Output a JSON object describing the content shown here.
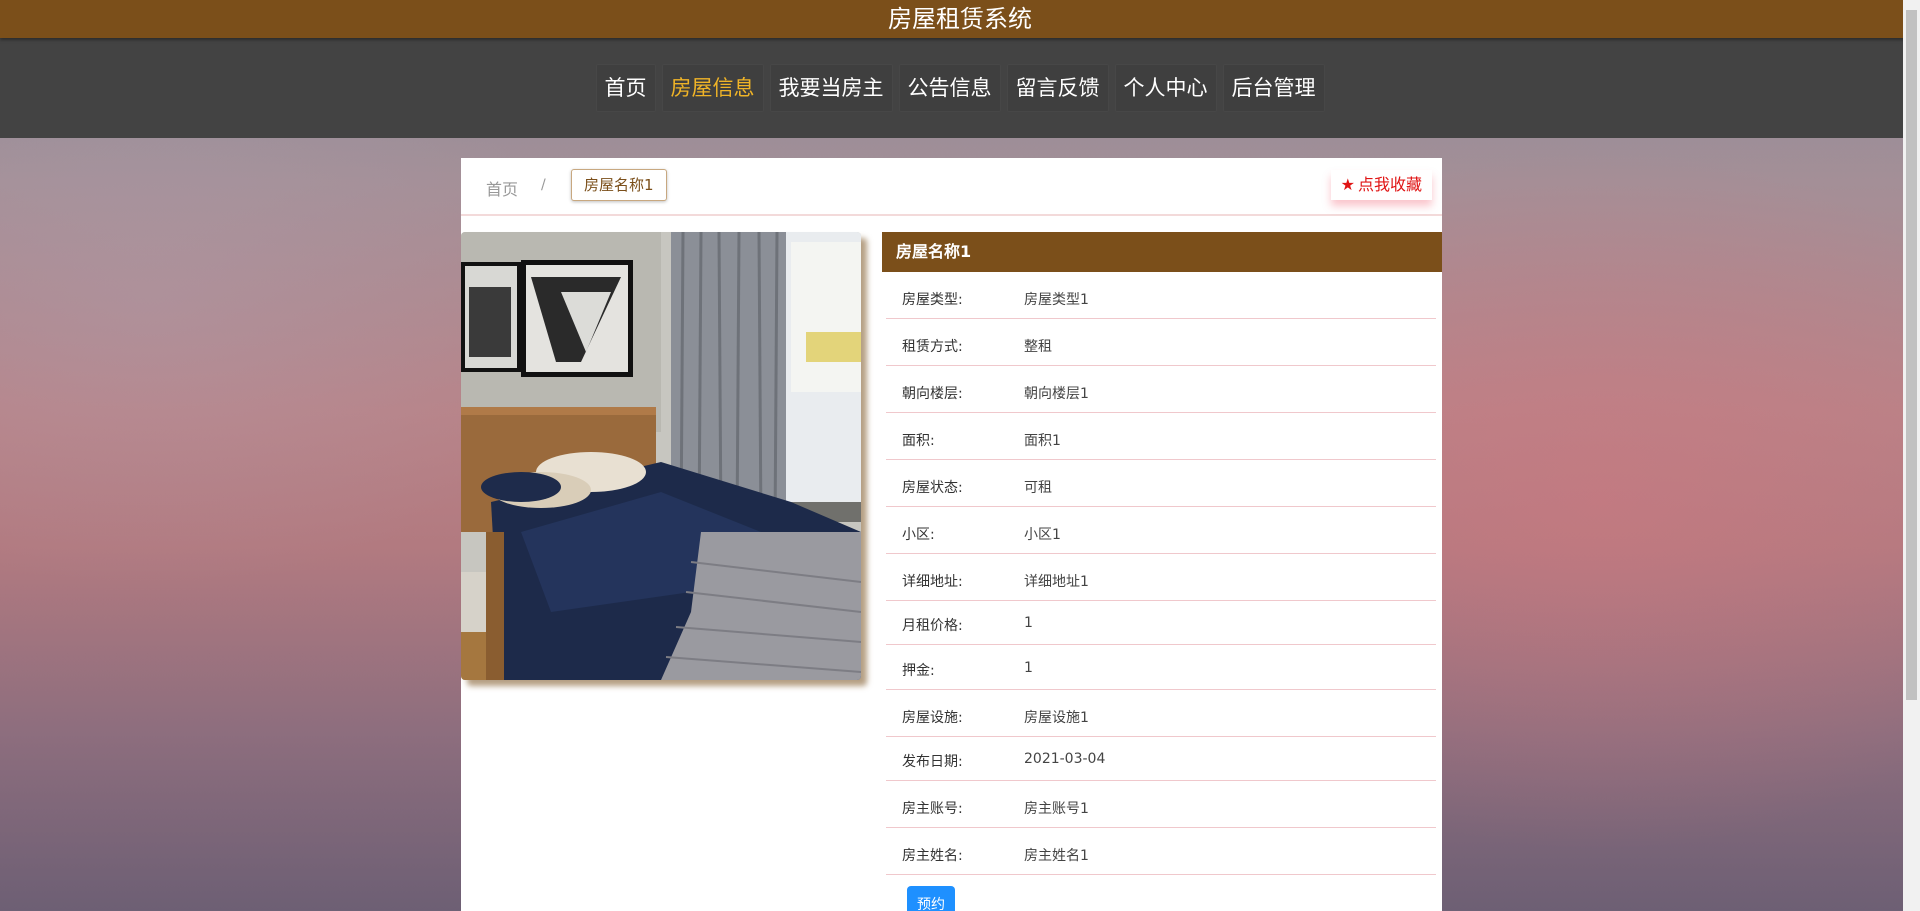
{
  "app": {
    "title": "房屋租赁系统"
  },
  "nav": {
    "items": [
      {
        "label": "首页"
      },
      {
        "label": "房屋信息"
      },
      {
        "label": "我要当房主"
      },
      {
        "label": "公告信息"
      },
      {
        "label": "留言反馈"
      },
      {
        "label": "个人中心"
      },
      {
        "label": "后台管理"
      }
    ],
    "active": "房屋信息"
  },
  "breadcrumb": {
    "home": "首页",
    "separator": "/",
    "current": "房屋名称1"
  },
  "favorite": {
    "icon": "star-icon",
    "label": "点我收藏"
  },
  "house": {
    "title": "房屋名称1",
    "fields": [
      {
        "label": "房屋类型:",
        "value": "房屋类型1"
      },
      {
        "label": "租赁方式:",
        "value": "整租"
      },
      {
        "label": "朝向楼层:",
        "value": "朝向楼层1"
      },
      {
        "label": "面积:",
        "value": "面积1"
      },
      {
        "label": "房屋状态:",
        "value": "可租"
      },
      {
        "label": "小区:",
        "value": "小区1"
      },
      {
        "label": "详细地址:",
        "value": "详细地址1"
      },
      {
        "label": "月租价格:",
        "value": "1"
      },
      {
        "label": "押金:",
        "value": "1"
      },
      {
        "label": "房屋设施:",
        "value": "房屋设施1"
      },
      {
        "label": "发布日期:",
        "value": "2021-03-04"
      },
      {
        "label": "房主账号:",
        "value": "房主账号1"
      },
      {
        "label": "房主姓名:",
        "value": "房主姓名1"
      }
    ],
    "book_label": "预约"
  },
  "colors": {
    "brand": "#7b4f1a",
    "nav_bg": "#434343",
    "nav_active": "#f0b427",
    "favorite": "#e01414",
    "book_button": "#1e90ff"
  }
}
